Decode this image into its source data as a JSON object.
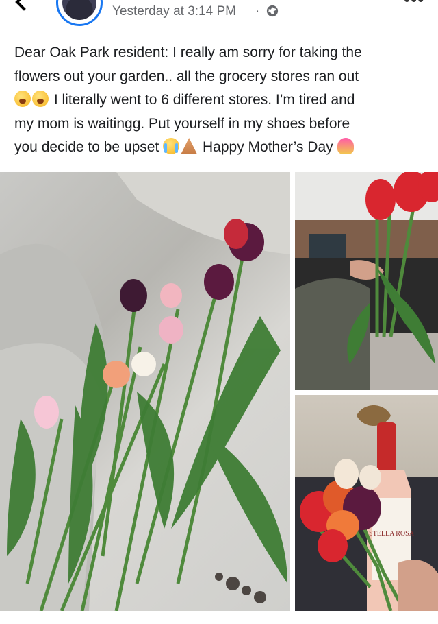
{
  "post": {
    "timestamp": "Yesterday at 3:14 PM",
    "separator": "·",
    "more_label": "•••",
    "text_lines": [
      "Dear Oak Park resident: I really am sorry for taking the",
      "flowers out your garden.. all the grocery stores ran out",
      " I literally went to 6 different stores. I’m tired and",
      "my mom is waitingg. Put yourself in my shoes before",
      "you decide to be upset",
      " Happy Mother’s Day"
    ]
  },
  "images": {
    "main": "Tulips lying on a car seat",
    "top_right": "Hand holding red tulips inside a car",
    "bottom_right": "Tulips with a bottle of Stella Rosa wine"
  },
  "bottle_label": "STELLA ROSA",
  "colors": {
    "accent": "#1877f2",
    "tulip_red": "#d9262f",
    "tulip_purple": "#5b1a3f",
    "stem_green": "#4f8a3c"
  },
  "icons": [
    "back-chevron-icon",
    "globe-icon",
    "more-options-icon"
  ]
}
